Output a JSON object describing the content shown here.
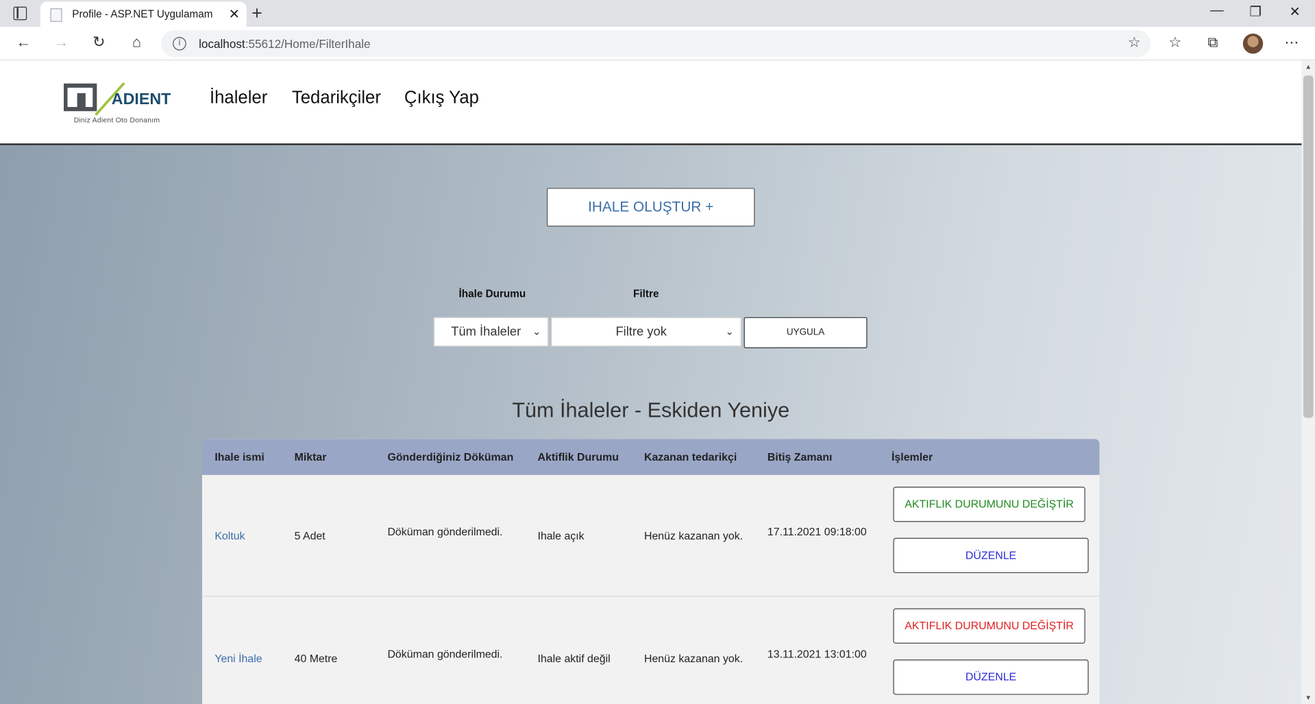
{
  "browser": {
    "tab_title": "Profile - ASP.NET Uygulamam",
    "url_host": "localhost",
    "url_rest": ":55612/Home/FilterIhale",
    "icons": [
      "tab-actions-icon",
      "favicon-icon",
      "close-icon",
      "new-tab-icon",
      "minimize-icon",
      "restore-icon",
      "close-window-icon",
      "back-icon",
      "forward-icon",
      "refresh-icon",
      "home-icon",
      "info-icon",
      "add-favorite-icon",
      "favorites-icon",
      "collections-icon",
      "profile-avatar",
      "more-icon"
    ]
  },
  "header": {
    "logo_text": "ADIENT",
    "logo_caption": "Diniz Adient Oto Donanım",
    "nav": [
      "İhaleler",
      "Tedarikçiler",
      "Çıkış Yap"
    ]
  },
  "actions": {
    "create_label": "IHALE OLUŞTUR +"
  },
  "filters": {
    "status_label": "İhale Durumu",
    "status_value": "Tüm İhaleler",
    "filter_label": "Filtre",
    "filter_value": "Filtre yok",
    "apply_label": "UYGULA"
  },
  "section_title": "Tüm İhaleler - Eskiden Yeniye",
  "table": {
    "headers": [
      "Ihale ismi",
      "Miktar",
      "Gönderdiğiniz Döküman",
      "Aktiflik Durumu",
      "Kazanan tedarikçi",
      "Bitiş Zamanı",
      "İşlemler"
    ],
    "rows": [
      {
        "name": "Koltuk",
        "amount": "5 Adet",
        "document": "Döküman gönderilmedi.",
        "status": "Ihale açık",
        "winner": "Henüz kazanan yok.",
        "end_time": "17.11.2021 09:18:00",
        "toggle_label": "AKTIFLIK DURUMUNU DEĞİŞTİR",
        "toggle_color": "#1f8a1f",
        "edit_label": "DÜZENLE"
      },
      {
        "name": "Yeni İhale",
        "amount": "40 Metre",
        "document": "Döküman gönderilmedi.",
        "status": "Ihale aktif değil",
        "winner": "Henüz kazanan yok.",
        "end_time": "13.11.2021 13:01:00",
        "toggle_label": "AKTIFLIK DURUMUNU DEĞİŞTİR",
        "toggle_color": "#e02020",
        "edit_label": "DÜZENLE"
      }
    ]
  }
}
